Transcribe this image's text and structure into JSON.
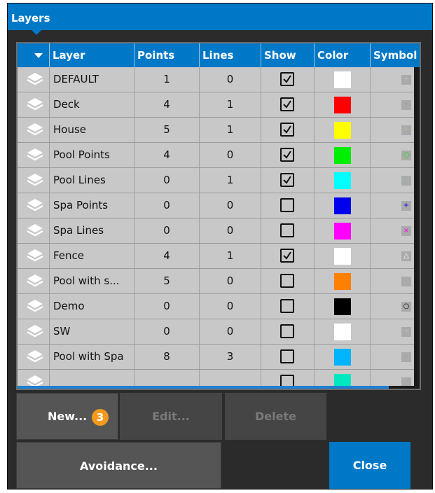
{
  "window": {
    "title": "Layers"
  },
  "table": {
    "columns": [
      "Layer",
      "Points",
      "Lines",
      "Show",
      "Color",
      "Symbol"
    ],
    "rows": [
      {
        "name": "DEFAULT",
        "points": "1",
        "lines": "0",
        "show": true,
        "color": "#ffffff",
        "symbol": "·",
        "symbol_color": "#ffffff"
      },
      {
        "name": "Deck",
        "points": "4",
        "lines": "1",
        "show": true,
        "color": "#ff0000",
        "symbol": "·",
        "symbol_color": "#ff0000"
      },
      {
        "name": "House",
        "points": "5",
        "lines": "1",
        "show": true,
        "color": "#ffff00",
        "symbol": "·",
        "symbol_color": "#ffff00"
      },
      {
        "name": "Pool Points",
        "points": "4",
        "lines": "0",
        "show": true,
        "color": "#00ee00",
        "symbol": "○",
        "symbol_color": "#00ee00"
      },
      {
        "name": "Pool Lines",
        "points": "0",
        "lines": "1",
        "show": true,
        "color": "#00ffff",
        "symbol": "·",
        "symbol_color": "#00ffff"
      },
      {
        "name": "Spa Points",
        "points": "0",
        "lines": "0",
        "show": false,
        "color": "#0000ee",
        "symbol": "+",
        "symbol_color": "#0000ee"
      },
      {
        "name": "Spa Lines",
        "points": "0",
        "lines": "0",
        "show": false,
        "color": "#ff00ff",
        "symbol": "×",
        "symbol_color": "#ff00ff"
      },
      {
        "name": "Fence",
        "points": "4",
        "lines": "1",
        "show": true,
        "color": "#ffffff",
        "symbol": "△",
        "symbol_color": "#ffffff"
      },
      {
        "name": "Pool with s...",
        "points": "5",
        "lines": "0",
        "show": false,
        "color": "#ff8000",
        "symbol": "·",
        "symbol_color": "#ff8000"
      },
      {
        "name": "Demo",
        "points": "0",
        "lines": "0",
        "show": false,
        "color": "#000000",
        "symbol": "○",
        "symbol_color": "#000000"
      },
      {
        "name": "SW",
        "points": "0",
        "lines": "0",
        "show": false,
        "color": "#ffffff",
        "symbol": "·",
        "symbol_color": "#ffffff"
      },
      {
        "name": "Pool with Spa",
        "points": "8",
        "lines": "3",
        "show": false,
        "color": "#00b4ff",
        "symbol": "·",
        "symbol_color": "#00b4ff"
      },
      {
        "name": "",
        "points": "",
        "lines": "",
        "show": false,
        "color": "#00e8c0",
        "symbol": "",
        "symbol_color": "#00e8c0"
      }
    ]
  },
  "buttons": {
    "new": "New...",
    "new_badge": "3",
    "edit": "Edit...",
    "delete": "Delete",
    "avoidance": "Avoidance...",
    "close": "Close"
  },
  "colors": {
    "accent": "#0078c8",
    "badge": "#f39a1e",
    "panel": "#2b2b2b"
  }
}
